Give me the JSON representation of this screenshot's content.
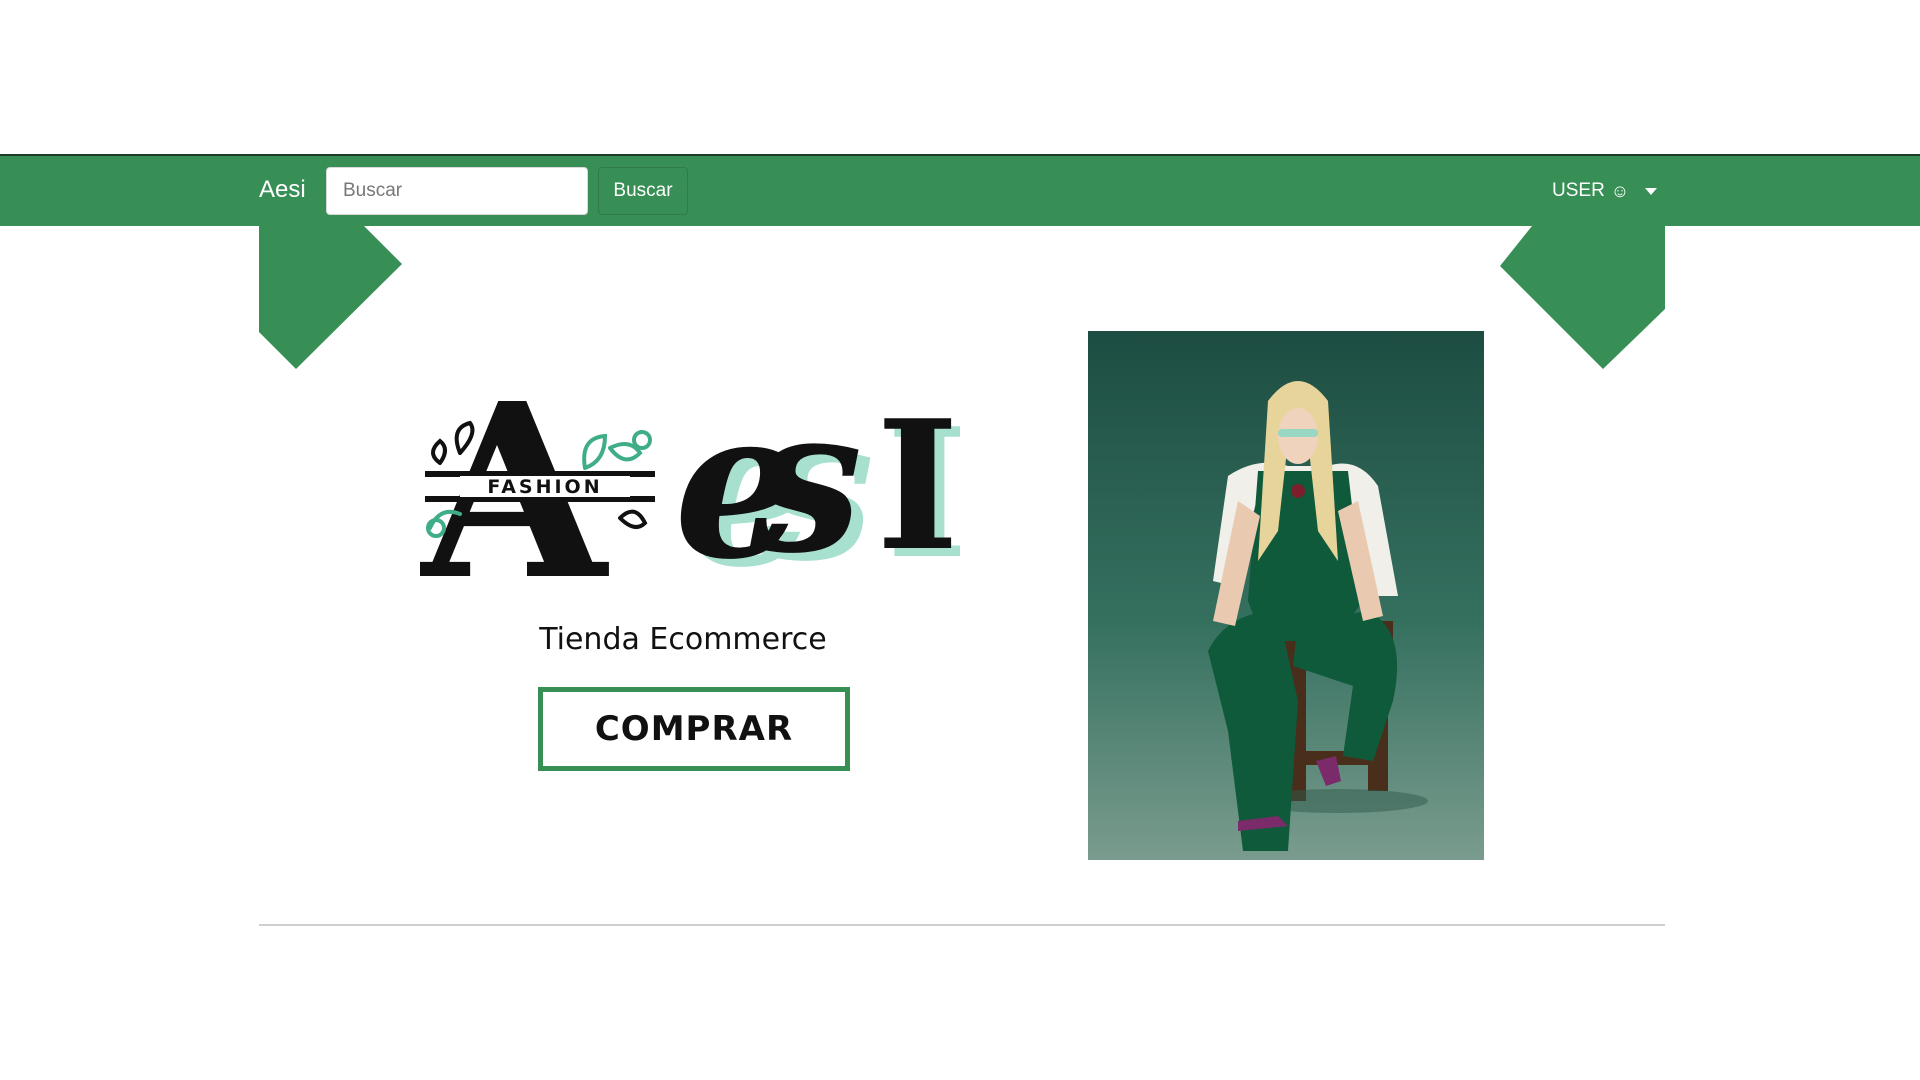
{
  "navbar": {
    "brand": "Aesi",
    "search_placeholder": "Buscar",
    "search_button": "Buscar",
    "user_label": "USER",
    "user_icon": "smiley-icon",
    "caret_icon": "chevron-down-icon"
  },
  "hero": {
    "logo_text": "AESI",
    "logo_tag": "FASHION",
    "subtitle": "Tienda Ecommerce",
    "buy_button": "COMPRAR"
  },
  "colors": {
    "brand_green": "#378f55",
    "mint": "#a8e0cf",
    "photo_bg": "#2b6450",
    "outfit_green": "#0f5a3a"
  }
}
